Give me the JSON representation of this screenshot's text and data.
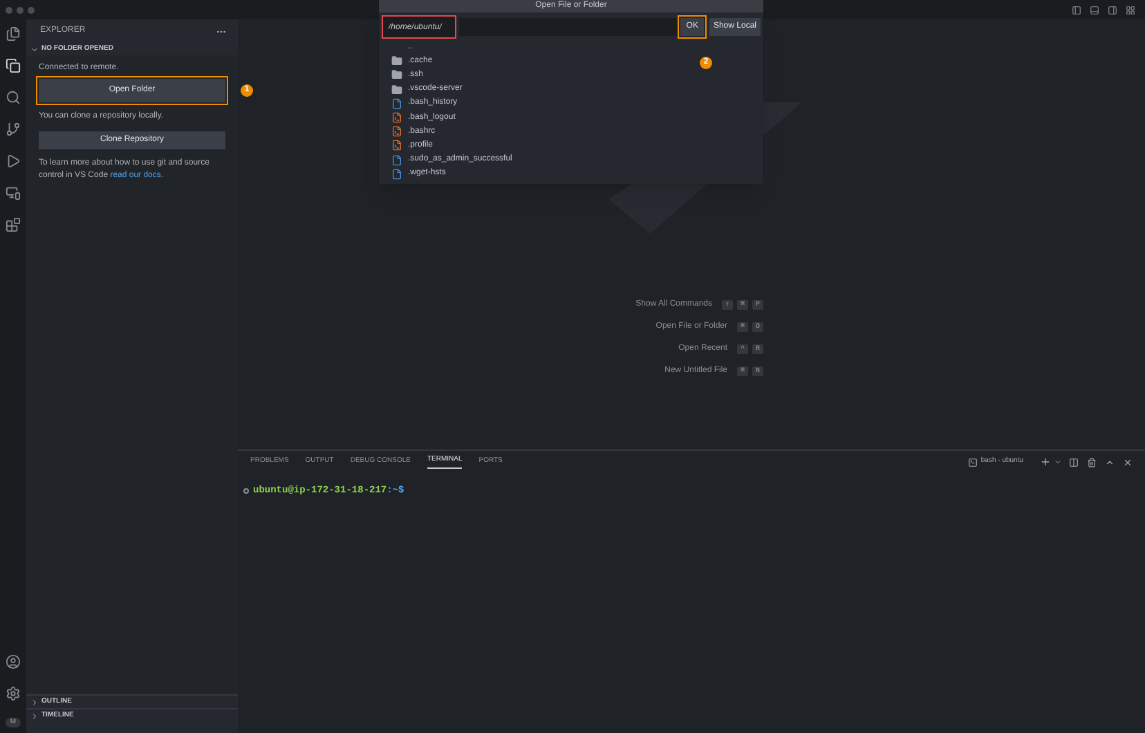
{
  "sidebar": {
    "title": "EXPLORER",
    "section": "NO FOLDER OPENED",
    "connected": "Connected to remote.",
    "open_button": {
      "label": "Open Folder",
      "annotation": "1"
    },
    "clone_text": "You can clone a repository locally.",
    "clone_button": "Clone Repository",
    "learn_text": "To learn more about how to use git and source control in VS Code",
    "learn_link": "read our docs",
    "learn_end": ".",
    "bottom_sections": [
      {
        "label": "OUTLINE",
        "expanded": false
      },
      {
        "label": "TIMELINE",
        "expanded": false
      }
    ]
  },
  "activity_bar": {
    "badge": "M"
  },
  "dialog": {
    "title": "Open File or Folder",
    "path": {
      "value": "/home/ubuntu/",
      "highlighted": true
    },
    "ok": {
      "label": "OK",
      "annotation": "2"
    },
    "show_local": "Show Local",
    "items": [
      {
        "name": "..",
        "kind": "parent"
      },
      {
        "name": ".cache",
        "kind": "folder"
      },
      {
        "name": ".ssh",
        "kind": "folder"
      },
      {
        "name": ".vscode-server",
        "kind": "folder"
      },
      {
        "name": ".bash_history",
        "kind": "file"
      },
      {
        "name": ".bash_logout",
        "kind": "script"
      },
      {
        "name": ".bashrc",
        "kind": "script"
      },
      {
        "name": ".profile",
        "kind": "script"
      },
      {
        "name": ".sudo_as_admin_successful",
        "kind": "file"
      },
      {
        "name": ".wget-hsts",
        "kind": "file"
      }
    ]
  },
  "shortcuts": [
    {
      "label": "Show All Commands",
      "keys": [
        "⇧",
        "⌘",
        "P"
      ]
    },
    {
      "label": "Open File or Folder",
      "keys": [
        "⌘",
        "O"
      ]
    },
    {
      "label": "Open Recent",
      "keys": [
        "^",
        "R"
      ]
    },
    {
      "label": "New Untitled File",
      "keys": [
        "⌘",
        "N"
      ]
    }
  ],
  "panel": {
    "tabs": [
      {
        "label": "PROBLEMS",
        "selected": false
      },
      {
        "label": "OUTPUT",
        "selected": false
      },
      {
        "label": "DEBUG CONSOLE",
        "selected": false
      },
      {
        "label": "TERMINAL",
        "selected": true
      },
      {
        "label": "PORTS",
        "selected": false
      }
    ],
    "terminal_name": "bash - ubuntu",
    "prompt_user": "ubuntu@ip-172-31-18-217",
    "prompt_path": ":~$"
  }
}
